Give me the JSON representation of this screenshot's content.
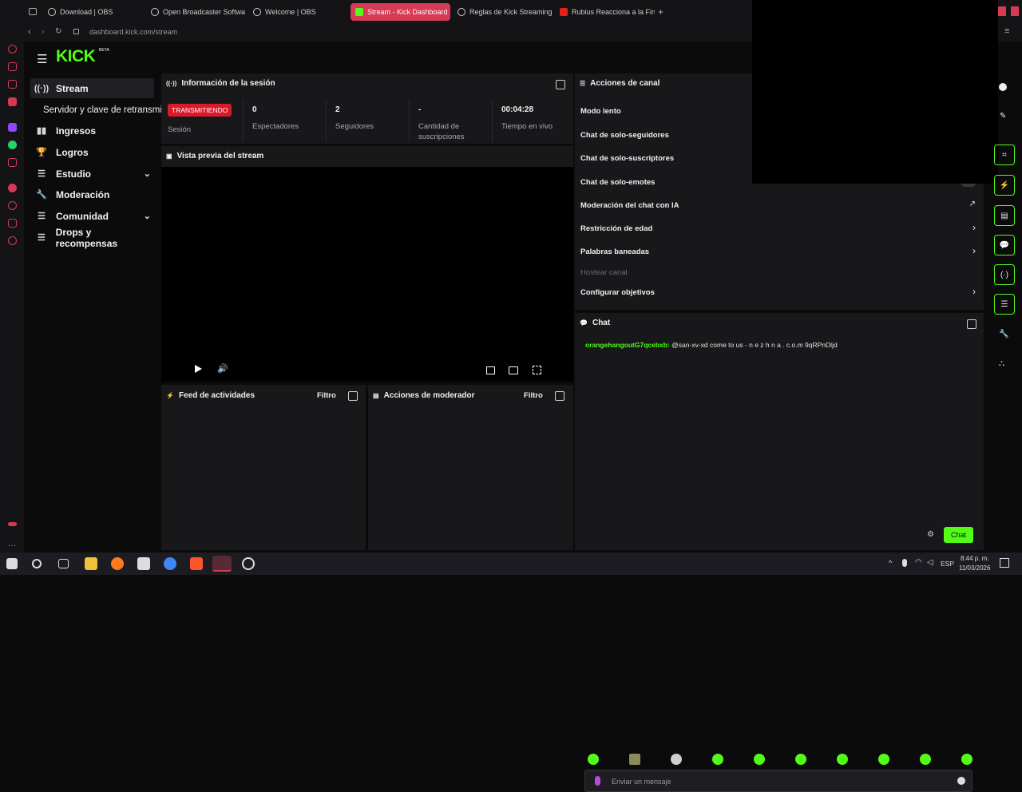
{
  "browser": {
    "tabs": [
      {
        "label": "Download | OBS"
      },
      {
        "label": "Open Broadcaster Softwa"
      },
      {
        "label": "Welcome | OBS"
      },
      {
        "label": "Stream - Kick Dashboard"
      },
      {
        "label": "Reglas de Kick Streaming"
      },
      {
        "label": "Rubius Reacciona a la Fin"
      }
    ],
    "url": "dashboard.kick.com/stream"
  },
  "brand": {
    "logo": "KICK",
    "beta": "BETA",
    "accent": "#53fc18"
  },
  "sidebar": {
    "items": [
      {
        "label": "Stream",
        "icon": "broadcast-icon"
      },
      {
        "label": "Servidor y clave de retransmi"
      },
      {
        "label": "Ingresos",
        "icon": "chart-icon"
      },
      {
        "label": "Logros",
        "icon": "trophy-icon"
      },
      {
        "label": "Estudio",
        "icon": "list-icon"
      },
      {
        "label": "Moderación",
        "icon": "wrench-icon"
      },
      {
        "label": "Comunidad",
        "icon": "list-icon"
      },
      {
        "label": "Drops y recompensas",
        "icon": "list-icon"
      }
    ]
  },
  "session": {
    "title": "Información de la sesión",
    "status_badge": "TRANSMITIENDO",
    "status_label": "Sesión",
    "viewers_value": "0",
    "viewers_label": "Espectadores",
    "followers_value": "2",
    "followers_label": "Seguidores",
    "subs_value": "-",
    "subs_label_1": "Cantidad de",
    "subs_label_2": "suscripciones",
    "live_value": "00:04:28",
    "live_label": "Tiempo en vivo"
  },
  "preview": {
    "title": "Vista previa del stream"
  },
  "channel_actions": {
    "title": "Acciones de canal",
    "items": [
      {
        "label": "Modo lento"
      },
      {
        "label": "Chat de solo-seguidores"
      },
      {
        "label": "Chat de solo-suscriptores"
      },
      {
        "label": "Chat de solo-emotes"
      },
      {
        "label": "Moderación del chat con IA"
      },
      {
        "label": "Restricción de edad"
      },
      {
        "label": "Palabras baneadas"
      },
      {
        "label": "Hostear canal"
      },
      {
        "label": "Configurar objetivos"
      }
    ]
  },
  "chat": {
    "title": "Chat",
    "messages": [
      {
        "user": "orangehangoutG7qcebxb:",
        "text": "@san-xv-xd come to us - n e z h n a . c.o.m 9qRPnDljd",
        "user_color": "#53fc18"
      }
    ],
    "input_placeholder": "Enviar un mensaje",
    "send_label": "Chat"
  },
  "activity_feed": {
    "title": "Feed de actividades",
    "filter": "Filtro"
  },
  "mod_actions": {
    "title": "Acciones de moderador",
    "filter": "Filtro"
  },
  "taskbar": {
    "lang": "ESP",
    "time": "8:44 p. m.",
    "date": "11/03/2026"
  }
}
